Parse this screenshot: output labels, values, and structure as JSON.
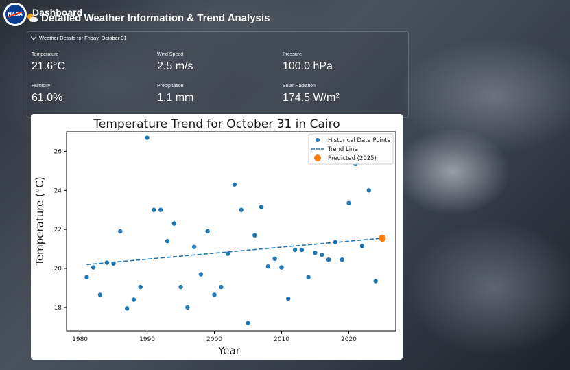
{
  "header": {
    "dashboard_label": "Dashboard",
    "title": "Detailed Weather Information & Trend Analysis",
    "logo_text": "NASA"
  },
  "weather_panel": {
    "heading": "Weather Details for Friday, October 31",
    "metrics": [
      {
        "label": "Temperature",
        "value": "21.6°C"
      },
      {
        "label": "Wind Speed",
        "value": "2.5 m/s"
      },
      {
        "label": "Pressure",
        "value": "100.0 hPa"
      },
      {
        "label": "Humidity",
        "value": "61.0%"
      },
      {
        "label": "Precipitation",
        "value": "1.1 mm"
      },
      {
        "label": "Solar Radiation",
        "value": "174.5 W/m²"
      }
    ]
  },
  "chart_data": {
    "type": "scatter",
    "title": "Temperature Trend for October 31 in Cairo",
    "xlabel": "Year",
    "ylabel": "Temperature (°C)",
    "xlim": [
      1978,
      2027
    ],
    "ylim": [
      16.8,
      27.0
    ],
    "xticks": [
      1980,
      1990,
      2000,
      2010,
      2020
    ],
    "yticks": [
      18,
      20,
      22,
      24,
      26
    ],
    "legend_position": "top-right",
    "grid": false,
    "series": [
      {
        "name": "Historical Data Points",
        "color": "#1f77b4",
        "points": [
          [
            1981,
            19.55
          ],
          [
            1982,
            20.05
          ],
          [
            1983,
            18.65
          ],
          [
            1984,
            20.3
          ],
          [
            1985,
            20.25
          ],
          [
            1986,
            21.9
          ],
          [
            1987,
            17.95
          ],
          [
            1988,
            18.4
          ],
          [
            1989,
            19.05
          ],
          [
            1990,
            26.7
          ],
          [
            1991,
            23.0
          ],
          [
            1992,
            23.0
          ],
          [
            1993,
            21.4
          ],
          [
            1994,
            22.3
          ],
          [
            1995,
            19.05
          ],
          [
            1996,
            18.0
          ],
          [
            1997,
            21.1
          ],
          [
            1998,
            19.7
          ],
          [
            1999,
            21.9
          ],
          [
            2000,
            18.65
          ],
          [
            2001,
            19.05
          ],
          [
            2002,
            20.75
          ],
          [
            2003,
            24.3
          ],
          [
            2004,
            23.0
          ],
          [
            2005,
            17.2
          ],
          [
            2006,
            21.7
          ],
          [
            2007,
            23.15
          ],
          [
            2008,
            20.1
          ],
          [
            2009,
            20.5
          ],
          [
            2010,
            20.05
          ],
          [
            2011,
            18.45
          ],
          [
            2012,
            20.95
          ],
          [
            2013,
            20.95
          ],
          [
            2014,
            19.55
          ],
          [
            2015,
            20.8
          ],
          [
            2016,
            20.7
          ],
          [
            2017,
            20.45
          ],
          [
            2018,
            21.35
          ],
          [
            2019,
            20.45
          ],
          [
            2020,
            23.35
          ],
          [
            2021,
            25.35
          ],
          [
            2022,
            21.15
          ],
          [
            2023,
            24.0
          ],
          [
            2024,
            19.35
          ]
        ]
      },
      {
        "name": "Trend Line",
        "color": "#1f77b4",
        "style": "dashed",
        "points": [
          [
            1981,
            20.2
          ],
          [
            2025,
            21.55
          ]
        ]
      },
      {
        "name": "Predicted (2025)",
        "color": "#ff7f0e",
        "points": [
          [
            2025,
            21.55
          ]
        ]
      }
    ]
  }
}
